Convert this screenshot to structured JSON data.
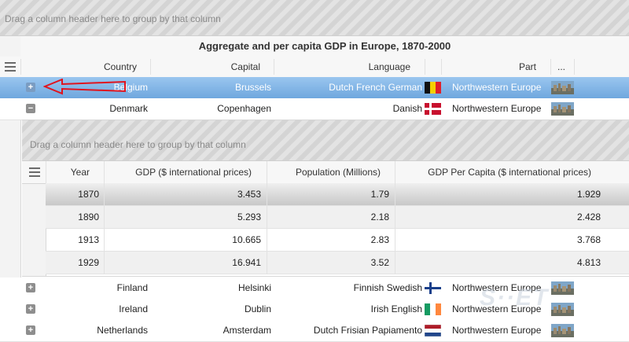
{
  "group_panel": {
    "text": "Drag a column header here to group by that column"
  },
  "grid": {
    "title": "Aggregate and per capita GDP in Europe, 1870-2000",
    "columns": {
      "country": "Country",
      "capital": "Capital",
      "language": "Language",
      "part": "Part",
      "more": "..."
    },
    "rows": [
      {
        "country": "Belgium",
        "capital": "Brussels",
        "language": "Dutch French German",
        "part": "Northwestern Europe",
        "flag": "belgium-flag",
        "toggle": "+"
      },
      {
        "country": "Denmark",
        "capital": "Copenhagen",
        "language": "Danish",
        "part": "Northwestern Europe",
        "flag": "denmark-flag",
        "toggle": "−"
      },
      {
        "country": "Finland",
        "capital": "Helsinki",
        "language": "Finnish Swedish",
        "part": "Northwestern Europe",
        "flag": "finland-flag",
        "toggle": "+"
      },
      {
        "country": "Ireland",
        "capital": "Dublin",
        "language": "Irish English",
        "part": "Northwestern Europe",
        "flag": "ireland-flag",
        "toggle": "+"
      },
      {
        "country": "Netherlands",
        "capital": "Amsterdam",
        "language": "Dutch Frisian Papiamento",
        "part": "Northwestern Europe",
        "flag": "netherlands-flag",
        "toggle": "+"
      }
    ]
  },
  "detail": {
    "group_panel": "Drag a column header here to group by that column",
    "columns": {
      "year": "Year",
      "gdp": "GDP ($ international prices)",
      "population": "Population (Millions)",
      "per_capita": "GDP Per Capita ($ international prices)"
    },
    "rows": [
      {
        "year": "1870",
        "gdp": "3.453",
        "population": "1.79",
        "per_capita": "1.929"
      },
      {
        "year": "1890",
        "gdp": "5.293",
        "population": "2.18",
        "per_capita": "2.428"
      },
      {
        "year": "1913",
        "gdp": "10.665",
        "population": "2.83",
        "per_capita": "3.768"
      },
      {
        "year": "1929",
        "gdp": "16.941",
        "population": "3.52",
        "per_capita": "4.813"
      }
    ]
  },
  "colors": {
    "selected_row": "#7fb2e5",
    "arrow": "#e0141e"
  }
}
